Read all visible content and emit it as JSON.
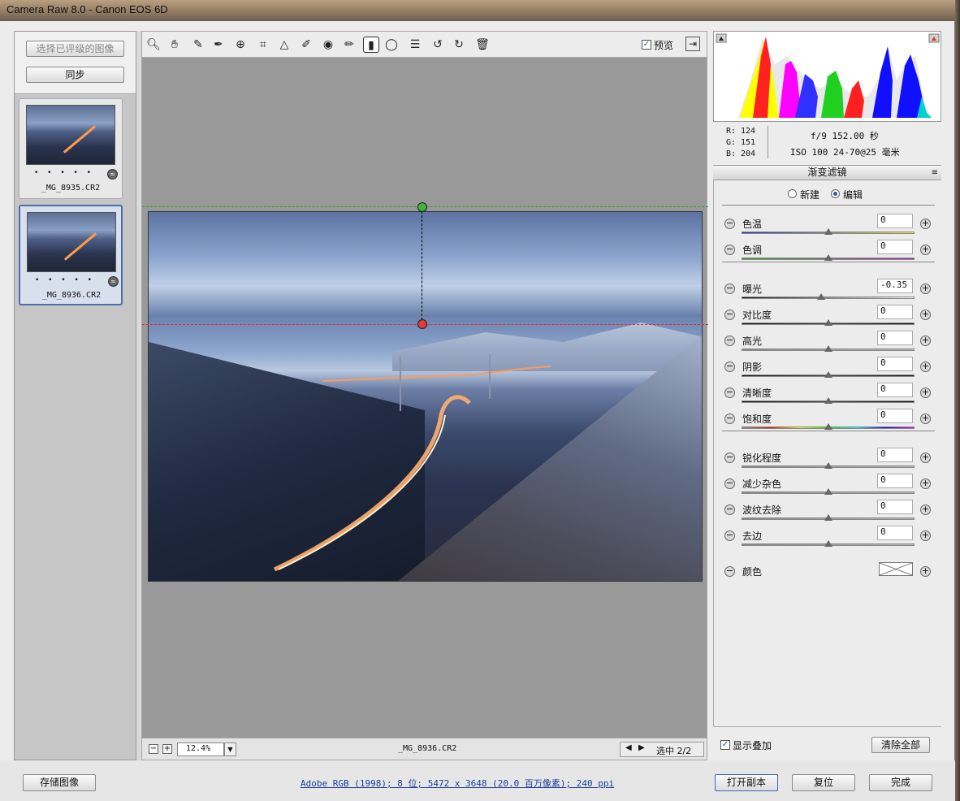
{
  "window": {
    "title": "Camera Raw 8.0 -  Canon EOS 6D"
  },
  "filmstrip": {
    "select_rated_label": "选择已评级的图像",
    "sync_label": "同步",
    "items": [
      {
        "filename": "_MG_8935.CR2",
        "stars": "• • • • •",
        "selected": false
      },
      {
        "filename": "_MG_8936.CR2",
        "stars": "• • • • •",
        "selected": true
      }
    ]
  },
  "toolbar": {
    "tools": [
      "zoom-icon",
      "hand-icon",
      "white-balance-icon",
      "color-sampler-icon",
      "target-adjust-icon",
      "crop-icon",
      "straighten-icon",
      "spot-removal-icon",
      "red-eye-icon",
      "adjustment-brush-icon",
      "graduated-filter-icon",
      "radial-filter-icon",
      "preferences-icon",
      "rotate-ccw-icon",
      "rotate-cw-icon",
      "trash-icon"
    ],
    "preview_label": "预览",
    "preview_checked": true
  },
  "status": {
    "zoom": "12.4%",
    "current_file": "_MG_8936.CR2",
    "selection_label": "选中 2/2"
  },
  "readout": {
    "r_label": "R:",
    "r": "124",
    "g_label": "G:",
    "g": "151",
    "b_label": "B:",
    "b": "204",
    "aperture_shutter": "f/9   152.00 秒",
    "iso_lens": "ISO 100   24-70@25 毫米"
  },
  "panel": {
    "title": "渐变滤镜",
    "mode_new": "新建",
    "mode_edit": "编辑",
    "mode_selected": "edit",
    "groups": [
      [
        {
          "label": "色温",
          "value": "0",
          "pos": 0.5,
          "track": "temp"
        },
        {
          "label": "色调",
          "value": "0",
          "pos": 0.5,
          "track": "tint"
        }
      ],
      [
        {
          "label": "曝光",
          "value": "-0.35",
          "pos": 0.46,
          "track": "exposure"
        },
        {
          "label": "对比度",
          "value": "0",
          "pos": 0.5,
          "track": "dark"
        },
        {
          "label": "高光",
          "value": "0",
          "pos": 0.5,
          "track": "plain"
        },
        {
          "label": "阴影",
          "value": "0",
          "pos": 0.5,
          "track": "dark"
        },
        {
          "label": "清晰度",
          "value": "0",
          "pos": 0.5,
          "track": "dark"
        },
        {
          "label": "饱和度",
          "value": "0",
          "pos": 0.5,
          "track": "sat"
        }
      ],
      [
        {
          "label": "锐化程度",
          "value": "0",
          "pos": 0.5,
          "track": "plain"
        },
        {
          "label": "减少杂色",
          "value": "0",
          "pos": 0.5,
          "track": "plain"
        },
        {
          "label": "波纹去除",
          "value": "0",
          "pos": 0.5,
          "track": "plain"
        },
        {
          "label": "去边",
          "value": "0",
          "pos": 0.5,
          "track": "plain"
        }
      ]
    ],
    "color_label": "颜色",
    "show_overlay_label": "显示叠加",
    "show_overlay_checked": true,
    "clear_all_label": "清除全部"
  },
  "bottom": {
    "save_label": "存储图像",
    "info_link": "Adobe RGB (1998); 8 位; 5472 x 3648 (20.0 百万像素); 240 ppi",
    "open_copy_label": "打开副本",
    "reset_label": "复位",
    "done_label": "完成"
  },
  "colors": {
    "accent": "#2a5ab0",
    "guide_start": "#2ca02c",
    "guide_end": "#e03030"
  }
}
